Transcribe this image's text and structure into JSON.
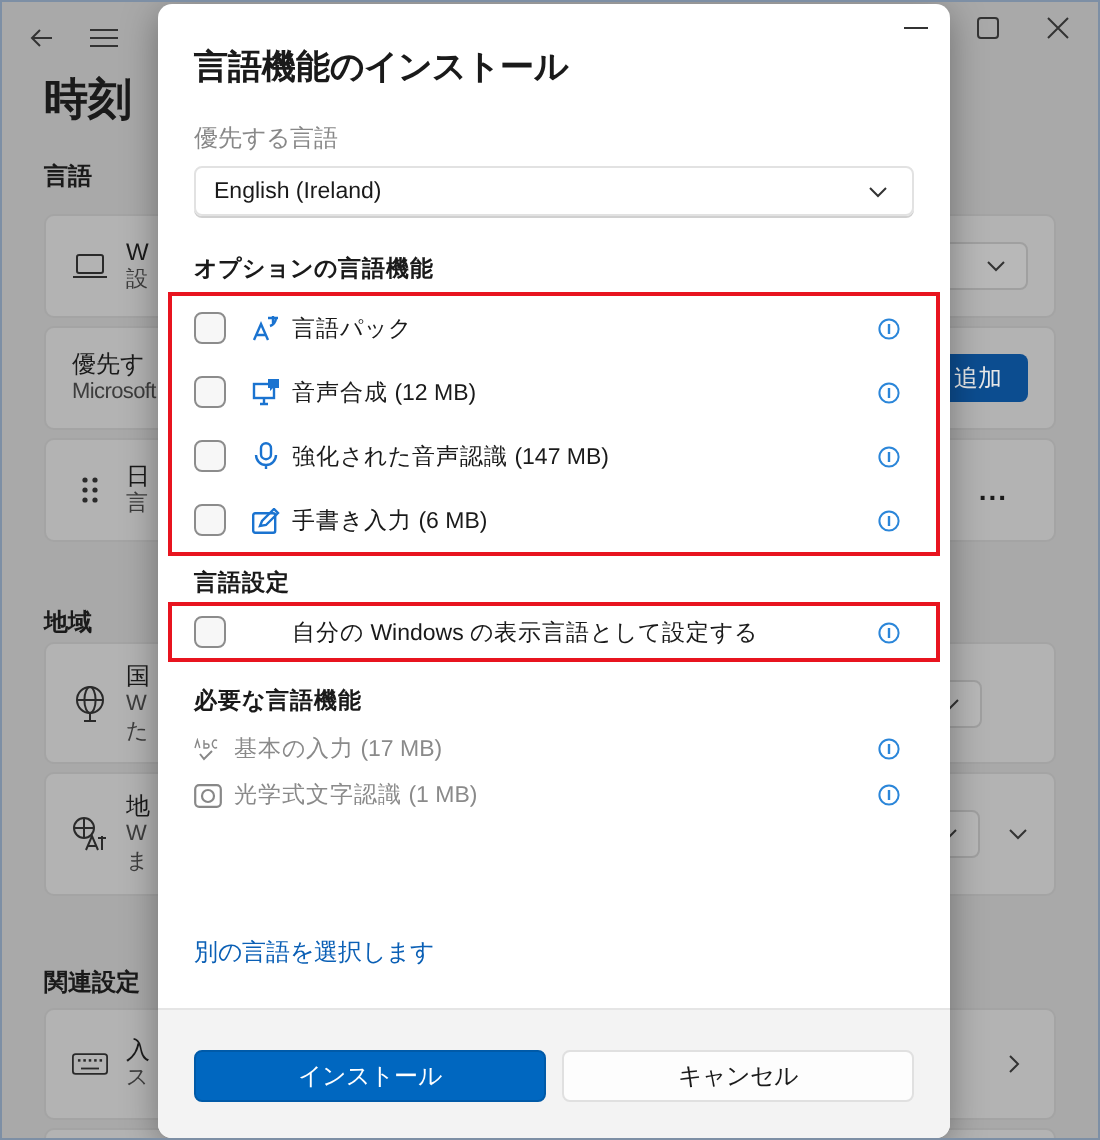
{
  "settings_window": {
    "heading": "時刻",
    "sections": [
      {
        "heading": "言語",
        "cards": [
          {
            "kind": "dropdown",
            "title": "W",
            "description": [
              "設"
            ]
          },
          {
            "kind": "button",
            "title": "優先す",
            "description": [
              "Microsoft"
            ],
            "button": "追加"
          },
          {
            "kind": "more",
            "title": "日",
            "description": [
              "言"
            ],
            "more": "..."
          }
        ]
      },
      {
        "heading": "地域",
        "cards": [
          {
            "kind": "dropdown",
            "title": "国",
            "description": [
              "W",
              "た"
            ]
          },
          {
            "kind": "expand",
            "title": "地",
            "description": [
              "W",
              "ま"
            ]
          }
        ]
      },
      {
        "heading": "関連設定",
        "cards": [
          {
            "kind": "link",
            "title": "入",
            "description": [
              "ス"
            ]
          },
          {
            "kind": "blank"
          }
        ]
      }
    ]
  },
  "dialog": {
    "title": "言語機能のインストール",
    "preferred_label": "優先する言語",
    "language_dropdown": {
      "value": "English (Ireland)"
    },
    "sections": [
      {
        "heading": "オプションの言語機能",
        "highlighted": true,
        "items": [
          {
            "kind": "checkbox",
            "label": "言語パック",
            "checked": false
          },
          {
            "kind": "checkbox",
            "label": "音声合成 (12 MB)",
            "checked": false
          },
          {
            "kind": "checkbox",
            "label": "強化された音声認識 (147 MB)",
            "checked": false
          },
          {
            "kind": "checkbox",
            "label": "手書き入力 (6 MB)",
            "checked": false
          }
        ]
      },
      {
        "heading": "言語設定",
        "highlighted": true,
        "items": [
          {
            "kind": "checkbox",
            "label": "自分の Windows の表示言語として設定する",
            "checked": false
          }
        ]
      },
      {
        "heading": "必要な言語機能",
        "highlighted": false,
        "items": [
          {
            "kind": "feature",
            "label": "基本の入力 (17 MB)",
            "disabled": true
          },
          {
            "kind": "feature",
            "label": "光学式文字認識 (1 MB)",
            "disabled": true
          }
        ]
      }
    ],
    "link": "別の言語を選択します",
    "buttons": [
      {
        "kind": "primary",
        "label": "インストール"
      },
      {
        "kind": "secondary",
        "label": "キャンセル"
      }
    ]
  }
}
